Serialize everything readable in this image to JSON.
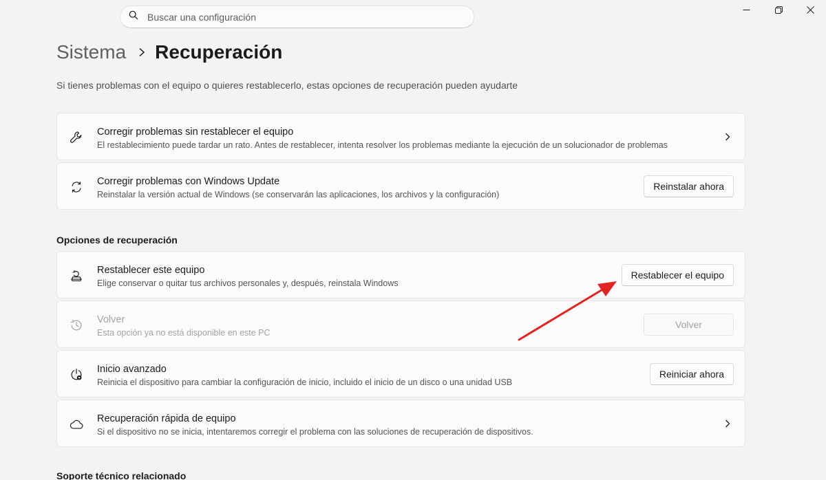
{
  "search": {
    "placeholder": "Buscar una configuración"
  },
  "window_controls": {
    "minimize_icon": "minimize-icon",
    "maximize_icon": "restore-icon",
    "close_icon": "close-icon"
  },
  "breadcrumb": {
    "parent": "Sistema",
    "current": "Recuperación"
  },
  "subtitle": "Si tienes problemas con el equipo o quieres restablecerlo, estas opciones de recuperación pueden ayudarte",
  "top_cards": [
    {
      "icon": "wrench-icon",
      "title": "Corregir problemas sin restablecer el equipo",
      "desc": "El restablecimiento puede tardar un rato. Antes de restablecer, intenta resolver los problemas mediante la ejecución de un solucionador de problemas"
    },
    {
      "icon": "sync-icon",
      "title": "Corregir problemas con Windows Update",
      "desc": "Reinstalar la versión actual de Windows (se conservarán las aplicaciones, los archivos y la configuración)",
      "button": "Reinstalar ahora"
    }
  ],
  "recovery_section": {
    "title": "Opciones de recuperación",
    "items": [
      {
        "icon": "reset-pc-icon",
        "title": "Restablecer este equipo",
        "desc": "Elige conservar o quitar tus archivos personales y, después, reinstala Windows",
        "button": "Restablecer el equipo"
      },
      {
        "icon": "history-icon",
        "title": "Volver",
        "desc": "Esta opción ya no está disponible en este PC",
        "button": "Volver",
        "disabled": true
      },
      {
        "icon": "advanced-startup-icon",
        "title": "Inicio avanzado",
        "desc": "Reinicia el dispositivo para cambiar la configuración de inicio, incluido el inicio de un disco o una unidad USB",
        "button": "Reiniciar ahora"
      },
      {
        "icon": "cloud-icon",
        "title": "Recuperación rápida de equipo",
        "desc": "Si el dispositivo no se inicia, intentaremos corregir el problema con las soluciones de recuperación de dispositivos."
      }
    ]
  },
  "related_section": {
    "title": "Soporte técnico relacionado"
  },
  "annotation": {
    "arrow_color": "#e02424"
  }
}
